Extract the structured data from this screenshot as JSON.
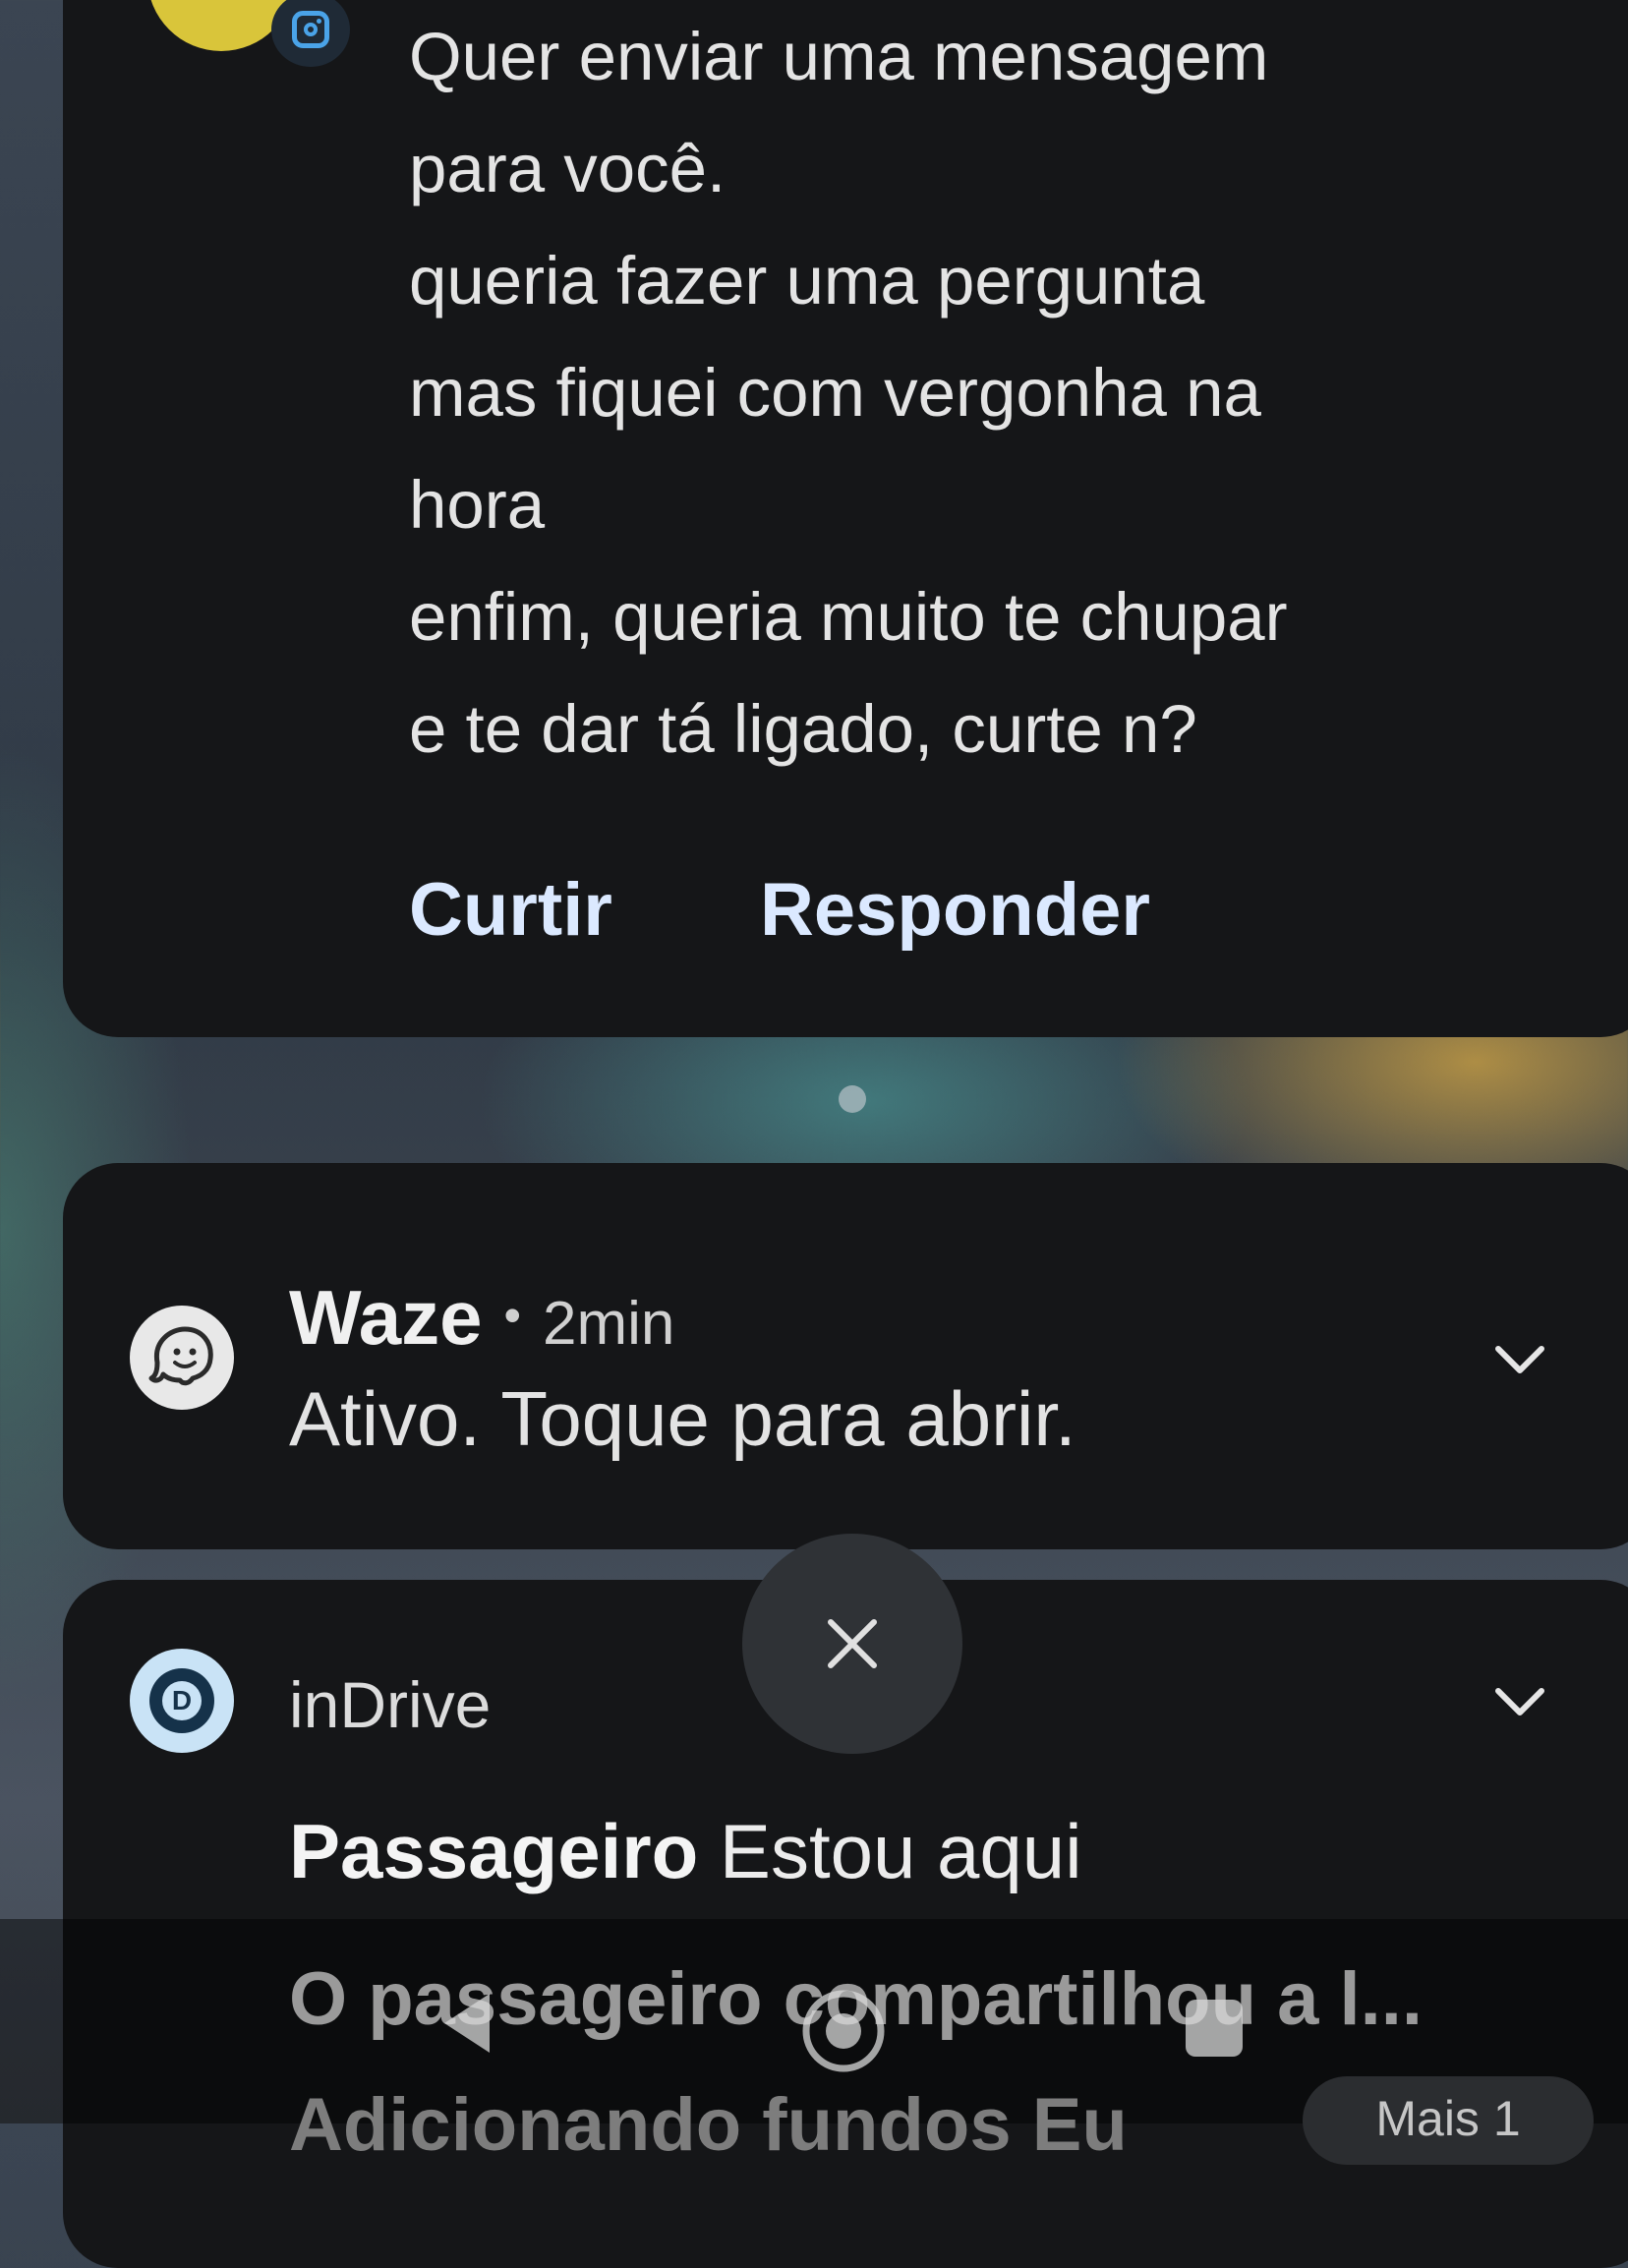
{
  "instagram_notification": {
    "message_lines": [
      "Quer enviar uma mensagem",
      "para você.",
      "queria fazer uma pergunta",
      "mas fiquei com vergonha na",
      "hora",
      "enfim, queria muito te chupar",
      "e te dar tá ligado, curte n?"
    ],
    "actions": {
      "like": "Curtir",
      "reply": "Responder"
    },
    "badge_icon": "instagram-icon"
  },
  "waze_notification": {
    "app_name": "Waze",
    "separator": "•",
    "time": "2min",
    "text": "Ativo. Toque para abrir.",
    "icon": "waze-icon"
  },
  "indrive_notification": {
    "app_name": "inDrive",
    "sender": "Passageiro",
    "message": "Estou aqui",
    "preview": "O passageiro compartilhou a l...",
    "partial_text": "Adicionando fundos Eu",
    "more_label": "Mais 1",
    "icon": "indrive-icon"
  },
  "close_button_icon": "close-icon",
  "navigation": [
    "back-icon",
    "home-icon",
    "recents-icon"
  ],
  "colors": {
    "card_bg": "#151618",
    "action_text": "#dbe9ff",
    "instagram_blue": "#4aa3e8"
  }
}
